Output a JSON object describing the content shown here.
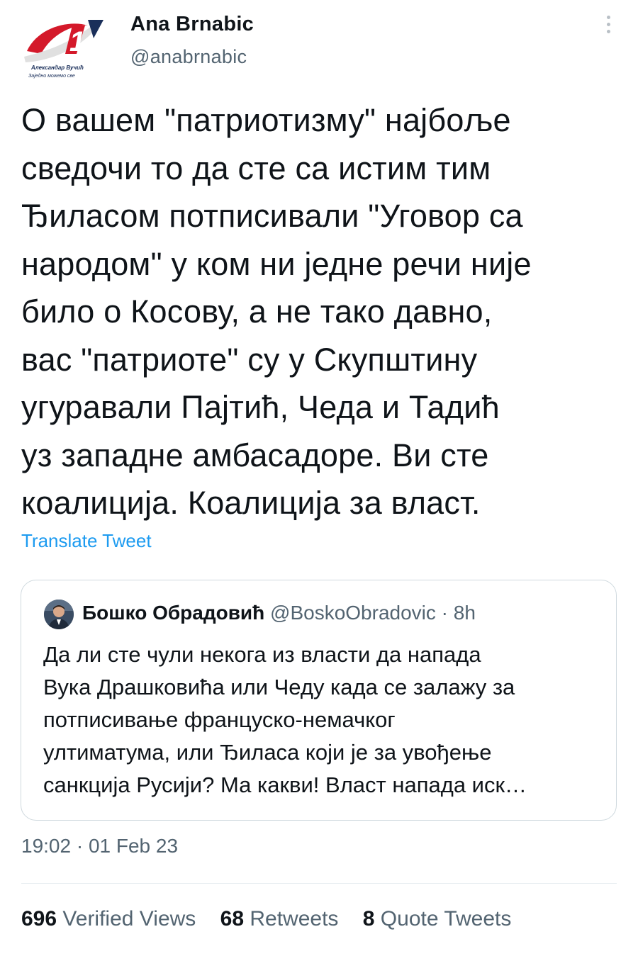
{
  "author": {
    "name": "Ana Brnabic",
    "handle": "@anabrnabic",
    "avatar_logo": {
      "number": "1",
      "line1": "Александар Вучић",
      "line2": "Заједно можемо све"
    }
  },
  "tweet": {
    "lines": [
      "О вашем \"патриотизму\" најбоље",
      "сведочи то да сте са истим тим",
      "Ђиласом потписивали \"Уговор са",
      "народом\" у ком ни једне речи није",
      "било о Косову, а не тако давно,",
      "вас \"патриоте\" су у Скупштину",
      "угуравали Пајтић, Чеда и Тадић",
      "уз западне амбасадоре. Ви сте",
      "коалиција. Коалиција за власт."
    ],
    "translate_label": "Translate Tweet"
  },
  "quoted_tweet": {
    "name": "Бошко Обрадовић",
    "handle": "@BoskoObradovic",
    "separator": "·",
    "time_ago": "8h",
    "lines": [
      "Да ли сте чули некога из власти да  напада",
      "Вука Драшковића или Чеду када се залажу за",
      "потписивање француско-немачког",
      "ултиматума, или Ђиласа који је за увођење",
      "санкција Русији? Ма какви! Власт напада иск…"
    ]
  },
  "timestamp": "19:02 · 01 Feb 23",
  "stats": {
    "views_count": "696",
    "views_label": "Verified Views",
    "retweets_count": "68",
    "retweets_label": "Retweets",
    "quotes_count": "8",
    "quotes_label": "Quote Tweets"
  },
  "colors": {
    "accent": "#1d9bf0",
    "text": "#0f1419",
    "muted": "#536471",
    "border": "#cfd9de",
    "logo_red": "#d4192a"
  },
  "icons": [
    "more-vertical-icon"
  ]
}
